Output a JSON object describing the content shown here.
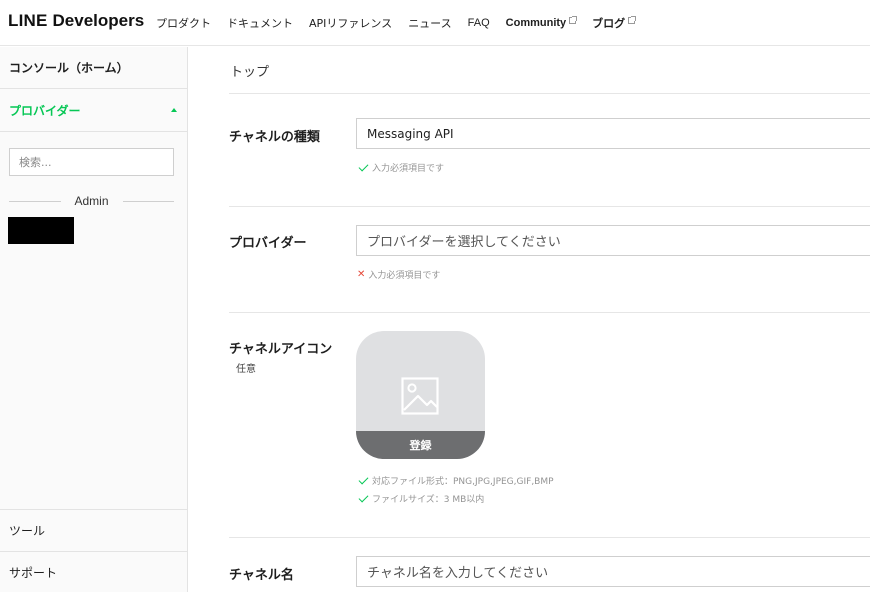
{
  "header": {
    "logo_bold": "LINE",
    "logo_rest": "Developers",
    "nav": [
      {
        "label": "プロダクト",
        "external": false
      },
      {
        "label": "ドキュメント",
        "external": false
      },
      {
        "label": "APIリファレンス",
        "external": false
      },
      {
        "label": "ニュース",
        "external": false
      },
      {
        "label": "FAQ",
        "external": false
      },
      {
        "label": "Community",
        "external": true
      },
      {
        "label": "ブログ",
        "external": true
      }
    ]
  },
  "sidebar": {
    "console": "コンソール（ホーム）",
    "provider": "プロバイダー",
    "search_placeholder": "検索...",
    "admin_label": "Admin",
    "tools": "ツール",
    "support": "サポート"
  },
  "main": {
    "breadcrumb": "トップ",
    "channel_type": {
      "label": "チャネルの種類",
      "value": "Messaging API",
      "hint": "入力必須項目です"
    },
    "provider": {
      "label": "プロバイダー",
      "placeholder": "プロバイダーを選択してください",
      "hint": "入力必須項目です"
    },
    "channel_icon": {
      "label": "チャネルアイコン",
      "optional": "任意",
      "upload": "登録",
      "hint_formats": "対応ファイル形式：PNG,JPG,JPEG,GIF,BMP",
      "hint_size": "ファイルサイズ：3 MB以内"
    },
    "channel_name": {
      "label": "チャネル名",
      "placeholder": "チャネル名を入力してください"
    }
  },
  "colors": {
    "accent": "#06c755",
    "error": "#e5493a",
    "icon_bg": "#dfe0e2",
    "upload_bar": "#6d6e70"
  }
}
